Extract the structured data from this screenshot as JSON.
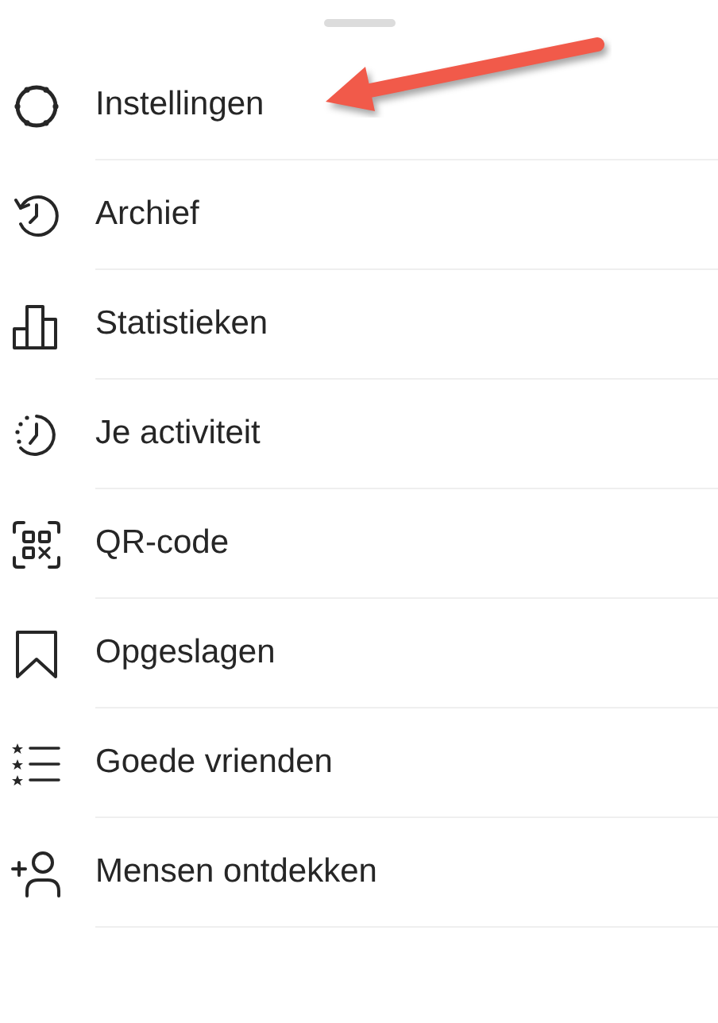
{
  "menu": {
    "items": [
      {
        "kind": "settings",
        "label": "Instellingen",
        "highlighted": true
      },
      {
        "kind": "archive",
        "label": "Archief",
        "highlighted": false
      },
      {
        "kind": "stats",
        "label": "Statistieken",
        "highlighted": false
      },
      {
        "kind": "activity",
        "label": "Je activiteit",
        "highlighted": false
      },
      {
        "kind": "qr",
        "label": "QR-code",
        "highlighted": false
      },
      {
        "kind": "saved",
        "label": "Opgeslagen",
        "highlighted": false
      },
      {
        "kind": "friends",
        "label": "Goede vrienden",
        "highlighted": false
      },
      {
        "kind": "discover",
        "label": "Mensen ontdekken",
        "highlighted": false
      }
    ]
  }
}
